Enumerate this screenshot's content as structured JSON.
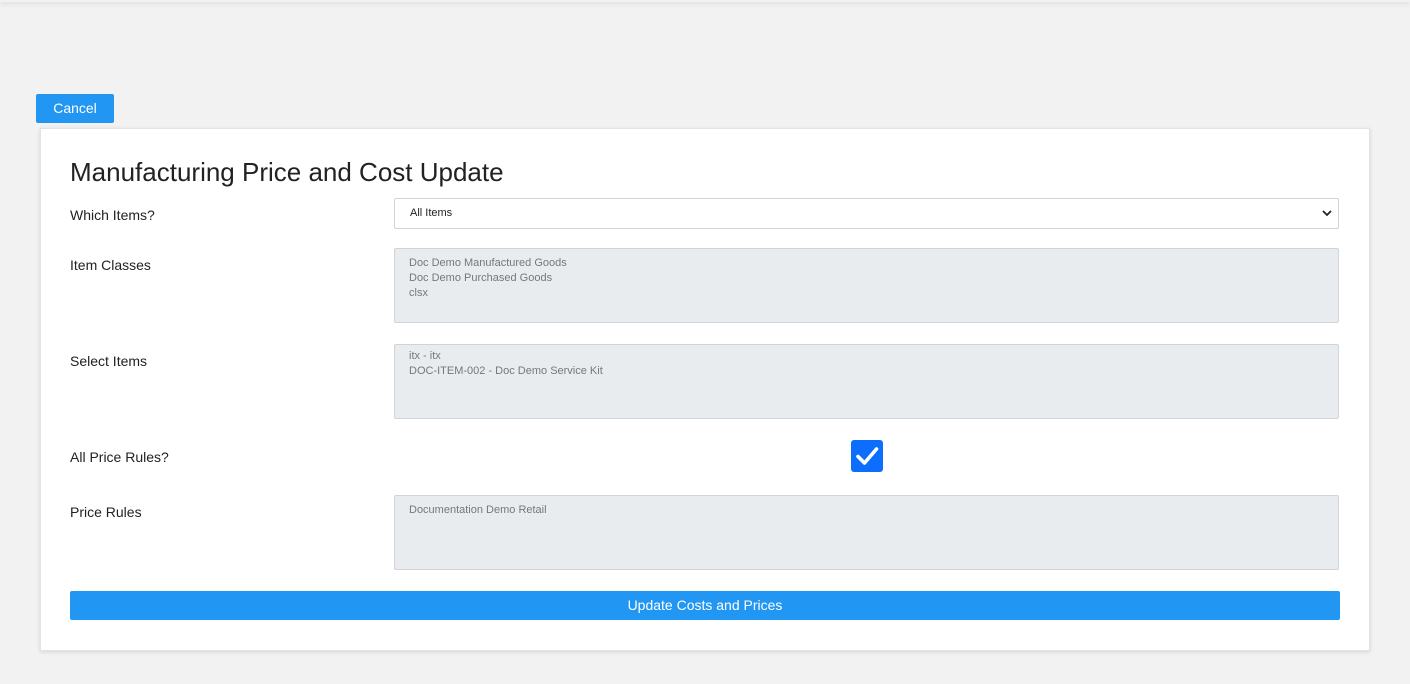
{
  "cancel_label": "Cancel",
  "form": {
    "title": "Manufacturing Price and Cost Update",
    "which_items": {
      "label": "Which Items?",
      "value": "All Items"
    },
    "item_classes": {
      "label": "Item Classes",
      "options": [
        "Doc Demo Manufactured Goods",
        "Doc Demo Purchased Goods",
        "clsx"
      ]
    },
    "select_items": {
      "label": "Select Items",
      "options": [
        "itx - itx",
        "DOC-ITEM-002 - Doc Demo Service Kit"
      ]
    },
    "all_price_rules": {
      "label": "All Price Rules?",
      "checked": true
    },
    "price_rules": {
      "label": "Price Rules",
      "options": [
        "Documentation Demo Retail"
      ]
    },
    "submit_label": "Update Costs and Prices"
  },
  "colors": {
    "accent": "#2196f3",
    "checkbox": "#0d6efd",
    "disabled_bg": "#e9ecef",
    "page_bg": "#f2f2f2"
  },
  "icons": {
    "dropdown": "chevron-down-icon",
    "check": "check-icon"
  }
}
